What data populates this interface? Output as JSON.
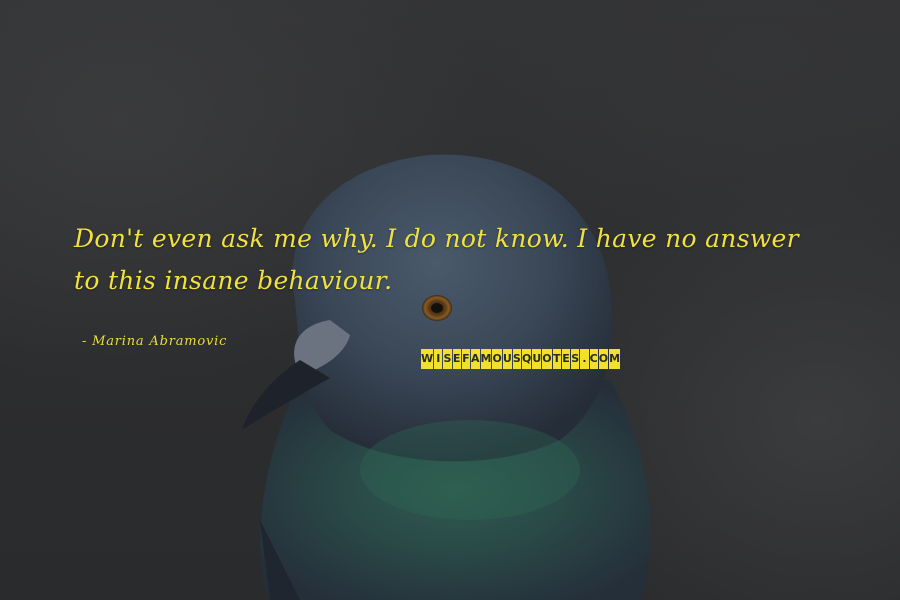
{
  "quote": {
    "line1": "Don't even ask me why. I do not know. I have no answer",
    "line2": "to this insane behaviour."
  },
  "author": "- Marina Abramovic",
  "watermark": "WISEFAMOUSQUOTES.COM",
  "colors": {
    "text": "#f0e040",
    "watermark_bg": "#f1e12a",
    "background": "#2f3032"
  }
}
